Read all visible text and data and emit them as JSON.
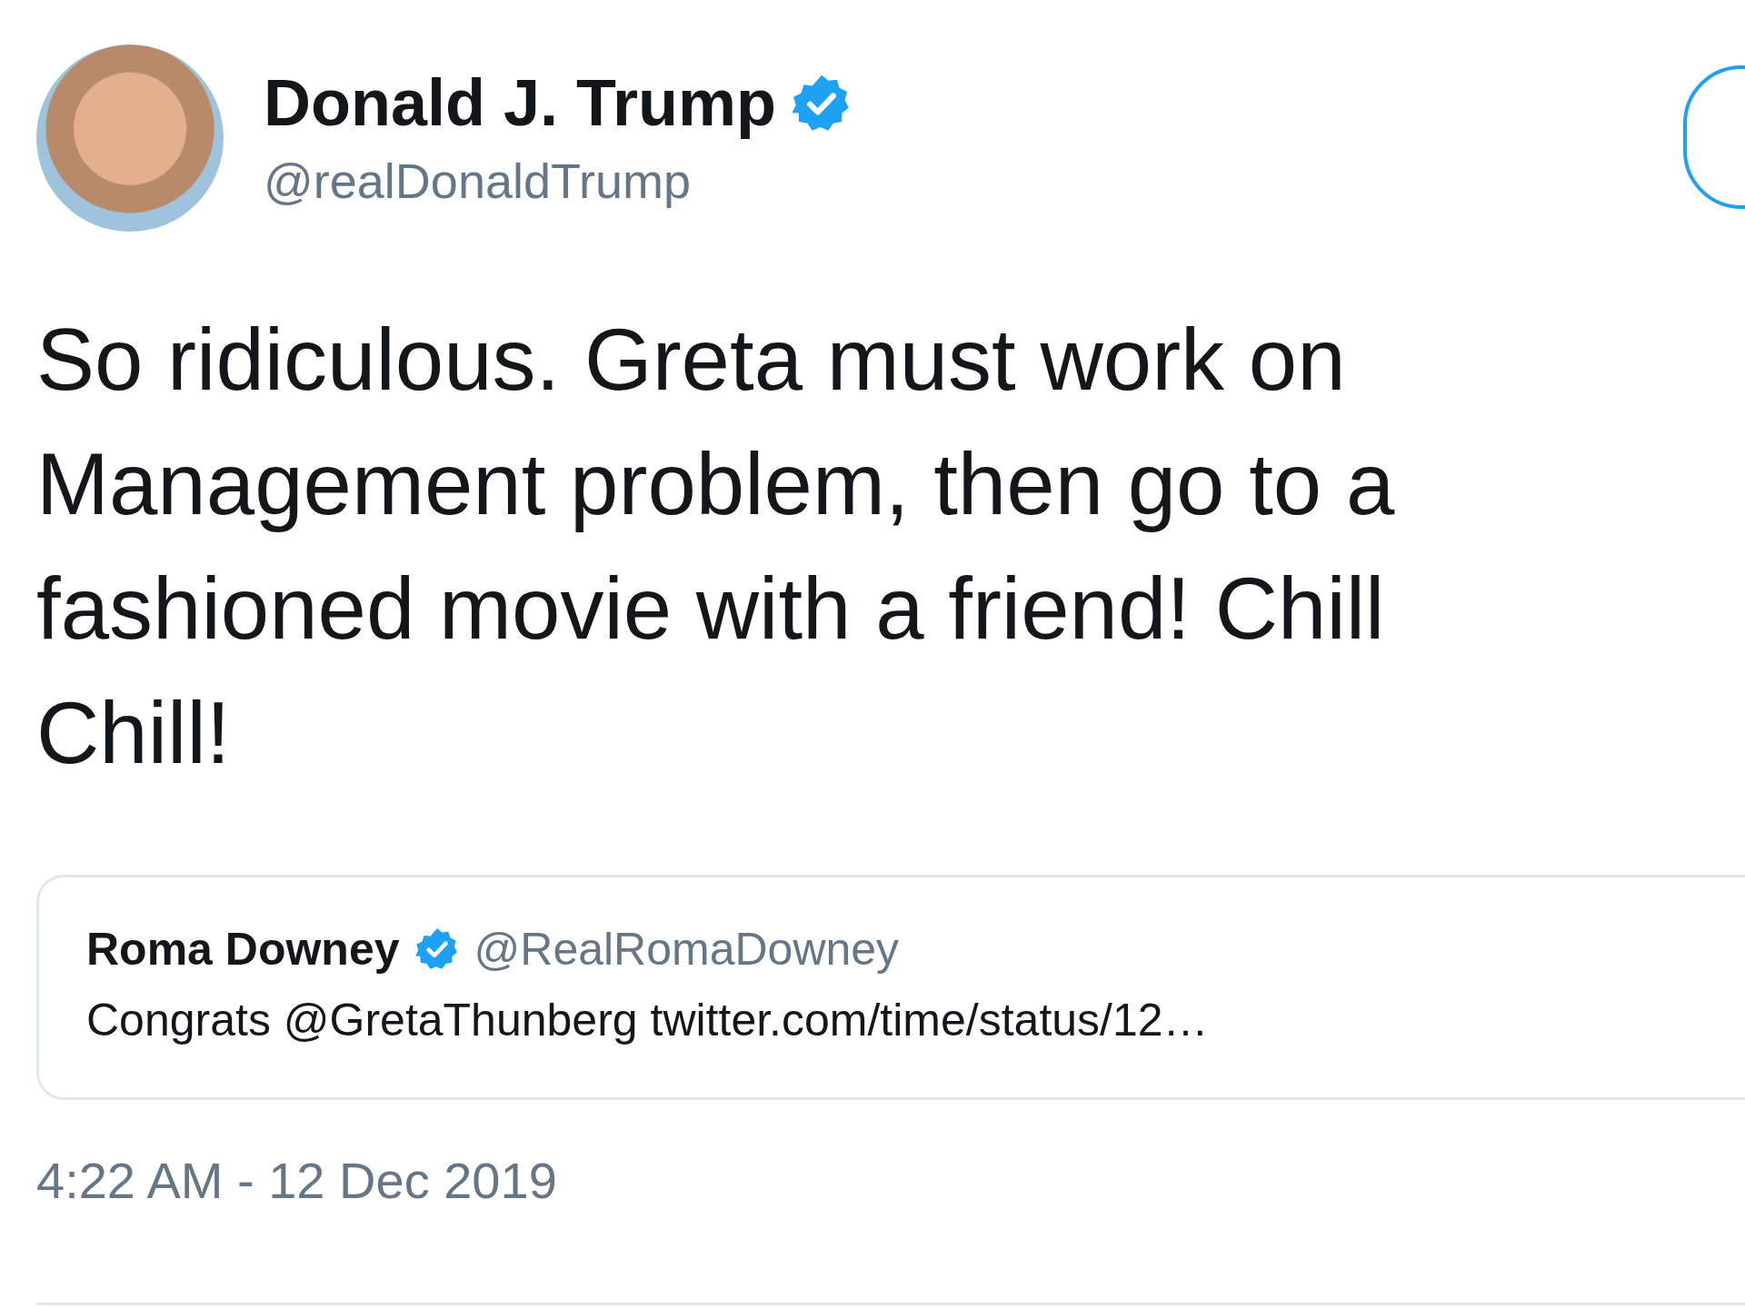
{
  "author": {
    "name": "Donald J. Trump",
    "handle": "@realDonaldTrump",
    "verified": true
  },
  "tweet_lines": [
    "So ridiculous. Greta must work on",
    "Management problem, then go to a",
    "fashioned movie with a friend! Chill",
    "Chill!"
  ],
  "quoted": {
    "name": "Roma Downey",
    "verified": true,
    "handle": "@RealRomaDowney",
    "text": "Congrats @GretaThunberg twitter.com/time/status/12…"
  },
  "timestamp": "4:22 AM - 12 Dec 2019"
}
